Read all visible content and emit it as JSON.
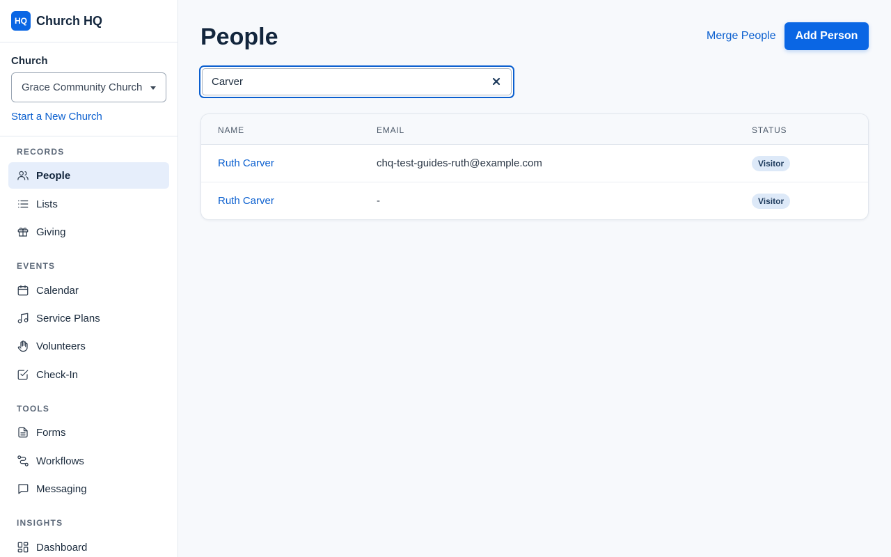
{
  "brand": {
    "logo": "HQ",
    "name": "Church HQ"
  },
  "church": {
    "label": "Church",
    "selected": "Grace Community Church",
    "new_church_link": "Start a New Church"
  },
  "nav": {
    "records": "RECORDS",
    "events": "EVENTS",
    "tools": "TOOLS",
    "insights": "INSIGHTS",
    "items": [
      {
        "label": "People",
        "icon": "users-icon",
        "active": true
      },
      {
        "label": "Lists",
        "icon": "list-icon"
      },
      {
        "label": "Giving",
        "icon": "gift-icon"
      },
      {
        "label": "Calendar",
        "icon": "calendar-icon"
      },
      {
        "label": "Service Plans",
        "icon": "music-note-icon"
      },
      {
        "label": "Volunteers",
        "icon": "hand-icon"
      },
      {
        "label": "Check-In",
        "icon": "checkbox-icon"
      },
      {
        "label": "Forms",
        "icon": "document-icon"
      },
      {
        "label": "Workflows",
        "icon": "workflow-icon"
      },
      {
        "label": "Messaging",
        "icon": "chat-icon"
      },
      {
        "label": "Dashboard",
        "icon": "dashboard-icon"
      }
    ]
  },
  "header": {
    "title": "People",
    "merge_label": "Merge People",
    "add_label": "Add Person"
  },
  "search": {
    "value": "Carver"
  },
  "table": {
    "columns": [
      "NAME",
      "EMAIL",
      "STATUS"
    ],
    "rows": [
      {
        "name": "Ruth Carver",
        "email": "chq-test-guides-ruth@example.com",
        "status": "Visitor"
      },
      {
        "name": "Ruth Carver",
        "email": "-",
        "status": "Visitor"
      }
    ]
  },
  "colors": {
    "accent": "#0a66e4",
    "link": "#0a5fcf",
    "badge_bg": "#dde9f8"
  }
}
